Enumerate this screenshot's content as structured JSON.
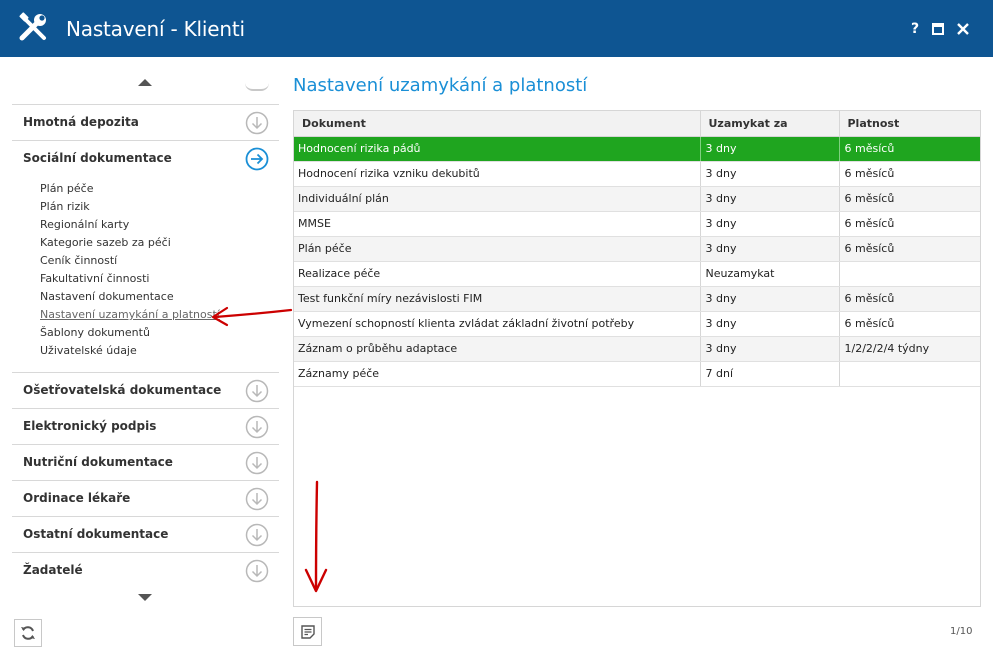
{
  "window": {
    "title": "Nastavení - Klienti",
    "help_label": "?"
  },
  "sidebar": {
    "sections_top": [
      {
        "label": "Hmotná depozita",
        "state": "collapsed"
      },
      {
        "label": "Sociální dokumentace",
        "state": "expanded"
      }
    ],
    "sub_items": [
      {
        "label": "Plán péče"
      },
      {
        "label": "Plán rizik"
      },
      {
        "label": "Regionální karty"
      },
      {
        "label": "Kategorie sazeb za péči"
      },
      {
        "label": "Ceník činností"
      },
      {
        "label": "Fakultativní činnosti"
      },
      {
        "label": "Nastavení dokumentace"
      },
      {
        "label": "Nastavení uzamykání a platností",
        "active": true
      },
      {
        "label": "Šablony dokumentů"
      },
      {
        "label": "Uživatelské údaje"
      }
    ],
    "sections_bottom": [
      {
        "label": "Ošetřovatelská dokumentace"
      },
      {
        "label": "Elektronický podpis"
      },
      {
        "label": "Nutriční dokumentace"
      },
      {
        "label": "Ordinace lékaře"
      },
      {
        "label": "Ostatní dokumentace"
      },
      {
        "label": "Žadatelé"
      }
    ]
  },
  "main": {
    "title": "Nastavení uzamykání a platností",
    "columns": [
      "Dokument",
      "Uzamykat za",
      "Platnost"
    ],
    "rows": [
      {
        "dokument": "Hodnocení rizika pádů",
        "uzamykat": "3 dny",
        "platnost": "6 měsíců",
        "selected": true
      },
      {
        "dokument": "Hodnocení rizika vzniku dekubitů",
        "uzamykat": "3 dny",
        "platnost": "6 měsíců"
      },
      {
        "dokument": "Individuální plán",
        "uzamykat": "3 dny",
        "platnost": "6 měsíců"
      },
      {
        "dokument": "MMSE",
        "uzamykat": "3 dny",
        "platnost": "6 měsíců"
      },
      {
        "dokument": "Plán péče",
        "uzamykat": "3 dny",
        "platnost": "6 měsíců"
      },
      {
        "dokument": "Realizace péče",
        "uzamykat": "Neuzamykat",
        "platnost": ""
      },
      {
        "dokument": "Test funkční míry nezávislosti FIM",
        "uzamykat": "3 dny",
        "platnost": "6 měsíců"
      },
      {
        "dokument": "Vymezení schopností klienta zvládat základní životní potřeby",
        "uzamykat": "3 dny",
        "platnost": "6 měsíců"
      },
      {
        "dokument": "Záznam o průběhu adaptace",
        "uzamykat": "3 dny",
        "platnost": "1/2/2/2/4 týdny"
      },
      {
        "dokument": "Záznamy péče",
        "uzamykat": "7 dní",
        "platnost": ""
      }
    ],
    "pager": "1/10"
  },
  "icons": {
    "app": "wrench-screwdriver-icon",
    "section_collapsed": "circle-arrow-down-icon",
    "section_expanded": "circle-arrow-right-icon",
    "refresh": "refresh-icon",
    "note": "note-icon"
  },
  "colors": {
    "titlebar": "#0e5592",
    "accent": "#1a8fd6",
    "selected_row": "#1fa51f",
    "annotation": "#cc0000"
  }
}
